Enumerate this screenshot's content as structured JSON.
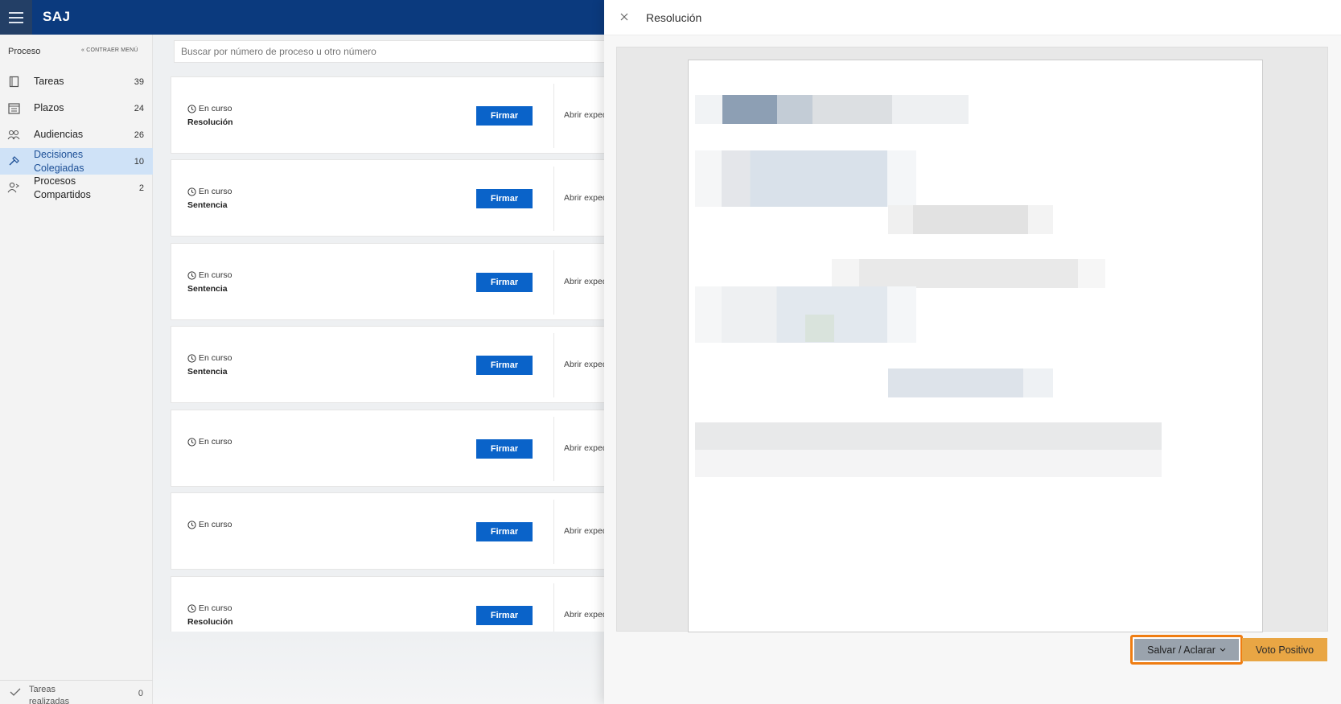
{
  "app": {
    "title": "SAJ"
  },
  "search": {
    "placeholder": "Buscar por número de proceso u otro número"
  },
  "sidebar": {
    "heading": "Proceso",
    "collapse_label": "CONTRAER MENÚ",
    "items": [
      {
        "label": "Tareas",
        "count": "39",
        "icon": "clipboard-icon"
      },
      {
        "label": "Plazos",
        "count": "24",
        "icon": "calendar-icon"
      },
      {
        "label": "Audiencias",
        "count": "26",
        "icon": "people-icon"
      },
      {
        "label_line1": "Decisiones",
        "label_line2": "Colegiadas",
        "count": "10",
        "icon": "gavel-icon",
        "active": true
      },
      {
        "label_line1": "Procesos",
        "label_line2": "Compartidos",
        "count": "2",
        "icon": "shared-users-icon"
      }
    ],
    "footer": {
      "label": "Tareas realizadas",
      "count": "0"
    }
  },
  "cards": [
    {
      "status": "En curso",
      "type": "Resolución",
      "sign_label": "Firmar",
      "open_label": "Abrir expediente"
    },
    {
      "status": "En curso",
      "type": "Sentencia",
      "sign_label": "Firmar",
      "open_label": "Abrir expediente"
    },
    {
      "status": "En curso",
      "type": "Sentencia",
      "sign_label": "Firmar",
      "open_label": "Abrir expediente"
    },
    {
      "status": "En curso",
      "type": "Sentencia",
      "sign_label": "Firmar",
      "open_label": "Abrir expediente"
    },
    {
      "status": "En curso",
      "type": "",
      "sign_label": "Firmar",
      "open_label": "Abrir expediente"
    },
    {
      "status": "En curso",
      "type": "",
      "sign_label": "Firmar",
      "open_label": "Abrir expediente"
    },
    {
      "status": "En curso",
      "type": "Resolución",
      "sign_label": "Firmar",
      "open_label": "Abrir expediente"
    }
  ],
  "panel": {
    "title": "Resolución",
    "save_label": "Salvar / Aclarar",
    "vote_label": "Voto Positivo"
  },
  "colors": {
    "topbar": "#0b3a7e",
    "primary_button": "#0a63c9",
    "highlight_outline": "#ef7d12",
    "vote_button": "#e9a644"
  }
}
